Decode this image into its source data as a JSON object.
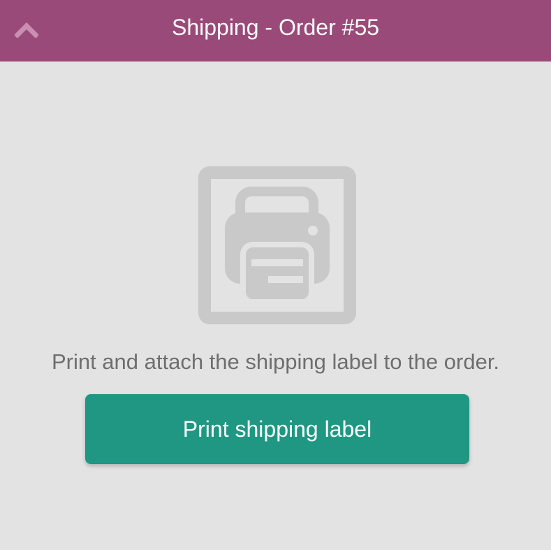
{
  "header": {
    "title": "Shipping - Order #55",
    "collapse_icon": "chevron-up-icon",
    "background_color": "#9a4a79"
  },
  "main": {
    "illustration_icon": "printer-icon",
    "message": "Print and attach the shipping label to the order.",
    "print_button_label": "Print shipping label",
    "button_color": "#1f9783"
  }
}
